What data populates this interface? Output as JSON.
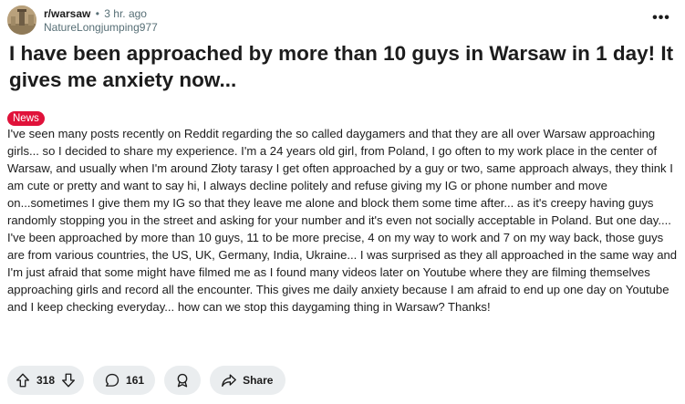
{
  "header": {
    "subreddit": "r/warsaw",
    "separator": "•",
    "time_ago": "3 hr. ago",
    "username": "NatureLongjumping977",
    "more_label": "•••"
  },
  "post": {
    "title": "I have been approached by more than 10 guys in Warsaw in 1 day! It gives me anxiety now...",
    "flair": "News",
    "body": "I've seen many posts recently on Reddit regarding the so called daygamers and that they are all over Warsaw approaching girls... so I decided to share my experience. I'm a 24 years old girl, from Poland, I go often to my work place in the center of Warsaw, and usually when I'm around Złoty tarasy I get often approached by a guy or two, same approach always, they think I am cute or pretty and want to say hi, I always decline politely and refuse giving my IG or phone number and move on...sometimes I give them my IG so that they leave me alone and block them some time after... as it's creepy having guys randomly stopping you in the street and asking for your number and it's even not socially acceptable in Poland. But one day.... I've been approached by more than 10 guys, 11 to be more precise, 4 on my way to work and 7 on my way back, those guys are from various countries, the US, UK, Germany, India, Ukraine... I was surprised as they all approached in the same way and I'm just afraid that some might have filmed me as I found many videos later on Youtube where they are filming themselves approaching girls and record all the encounter. This gives me daily anxiety because I am afraid to end up one day on Youtube and I keep checking everyday... how can we stop this daygaming thing in Warsaw? Thanks!"
  },
  "actions": {
    "upvotes": "318",
    "comments": "161",
    "share_label": "Share"
  },
  "icons": {
    "upvote": "upvote-arrow-icon",
    "downvote": "downvote-arrow-icon",
    "comment": "comment-bubble-icon",
    "award": "award-icon",
    "share": "share-arrow-icon",
    "more": "more-options-icon"
  },
  "colors": {
    "flair_bg": "#e0123a",
    "pill_bg": "#eaedef",
    "meta_text": "#576f76",
    "text": "#1c1c1c"
  }
}
